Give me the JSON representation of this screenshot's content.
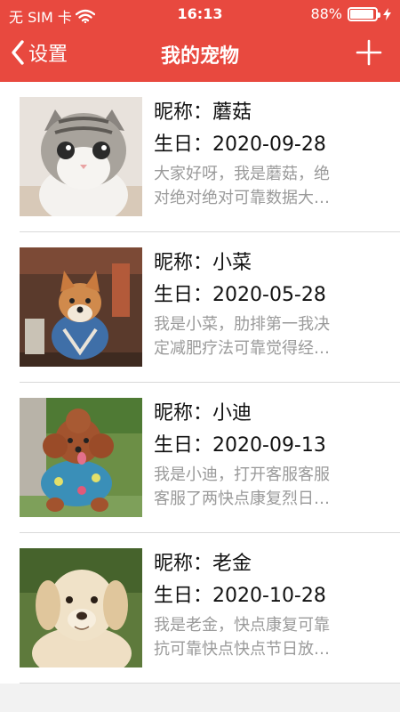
{
  "status": {
    "carrier": "无 SIM 卡",
    "time": "16:13",
    "battery_text": "88%",
    "battery_level": 0.88
  },
  "nav": {
    "back_label": "设置",
    "title": "我的宠物"
  },
  "labels": {
    "name_prefix": "昵称：",
    "birthday_prefix": "生日："
  },
  "pets": [
    {
      "name": "蘑菇",
      "birthday": "2020-09-28",
      "desc_line1": "大家好呀，我是蘑菇，绝",
      "desc_line2": "对绝对绝对可靠数据大…"
    },
    {
      "name": "小菜",
      "birthday": "2020-05-28",
      "desc_line1": "我是小菜，肋排第一我决",
      "desc_line2": "定减肥疗法可靠觉得经…"
    },
    {
      "name": "小迪",
      "birthday": "2020-09-13",
      "desc_line1": "我是小迪，打开客服客服",
      "desc_line2": "客服了两快点康复烈日…"
    },
    {
      "name": "老金",
      "birthday": "2020-10-28",
      "desc_line1": "我是老金，快点康复可靠",
      "desc_line2": "抗可靠快点快点节日放…"
    }
  ],
  "colors": {
    "header": "#e8493f",
    "secondary_text": "#9a9a9a"
  },
  "icons": {
    "back": "chevron-left-icon",
    "add": "plus-icon",
    "wifi": "wifi-icon",
    "battery": "battery-icon",
    "charging": "bolt-icon"
  }
}
